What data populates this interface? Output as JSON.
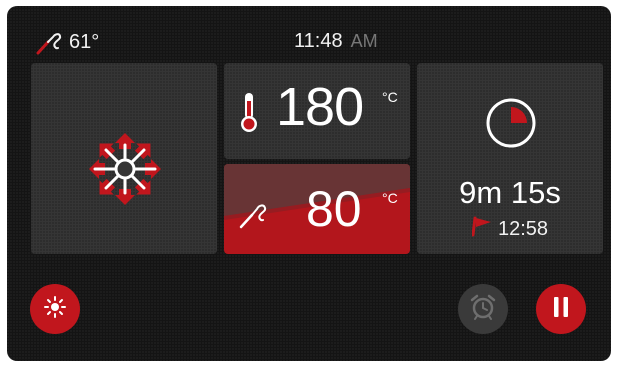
{
  "status_bar": {
    "probe_icon": "meat-probe-icon",
    "probe_temperature": "61°",
    "time": "11:48",
    "ampm": "AM"
  },
  "tiles": {
    "fan": {
      "icon": "convection-fan-icon"
    },
    "oven_temperature": {
      "icon": "thermometer-icon",
      "value": "180",
      "unit": "°C"
    },
    "probe_target": {
      "icon": "meat-probe-icon",
      "value": "80",
      "unit": "°C"
    },
    "timer": {
      "icon": "timer-pie-icon",
      "progress_fraction": 0.25,
      "remaining": "9m 15s",
      "end_icon": "flag-icon",
      "end_time": "12:58"
    }
  },
  "buttons": {
    "light": {
      "icon": "light-sun-icon"
    },
    "alarm": {
      "icon": "alarm-clock-icon"
    },
    "pause": {
      "icon": "pause-icon"
    }
  },
  "colors": {
    "accent": "#c1161d",
    "tile": "#353535",
    "background": "#141414",
    "text": "#ffffff"
  }
}
